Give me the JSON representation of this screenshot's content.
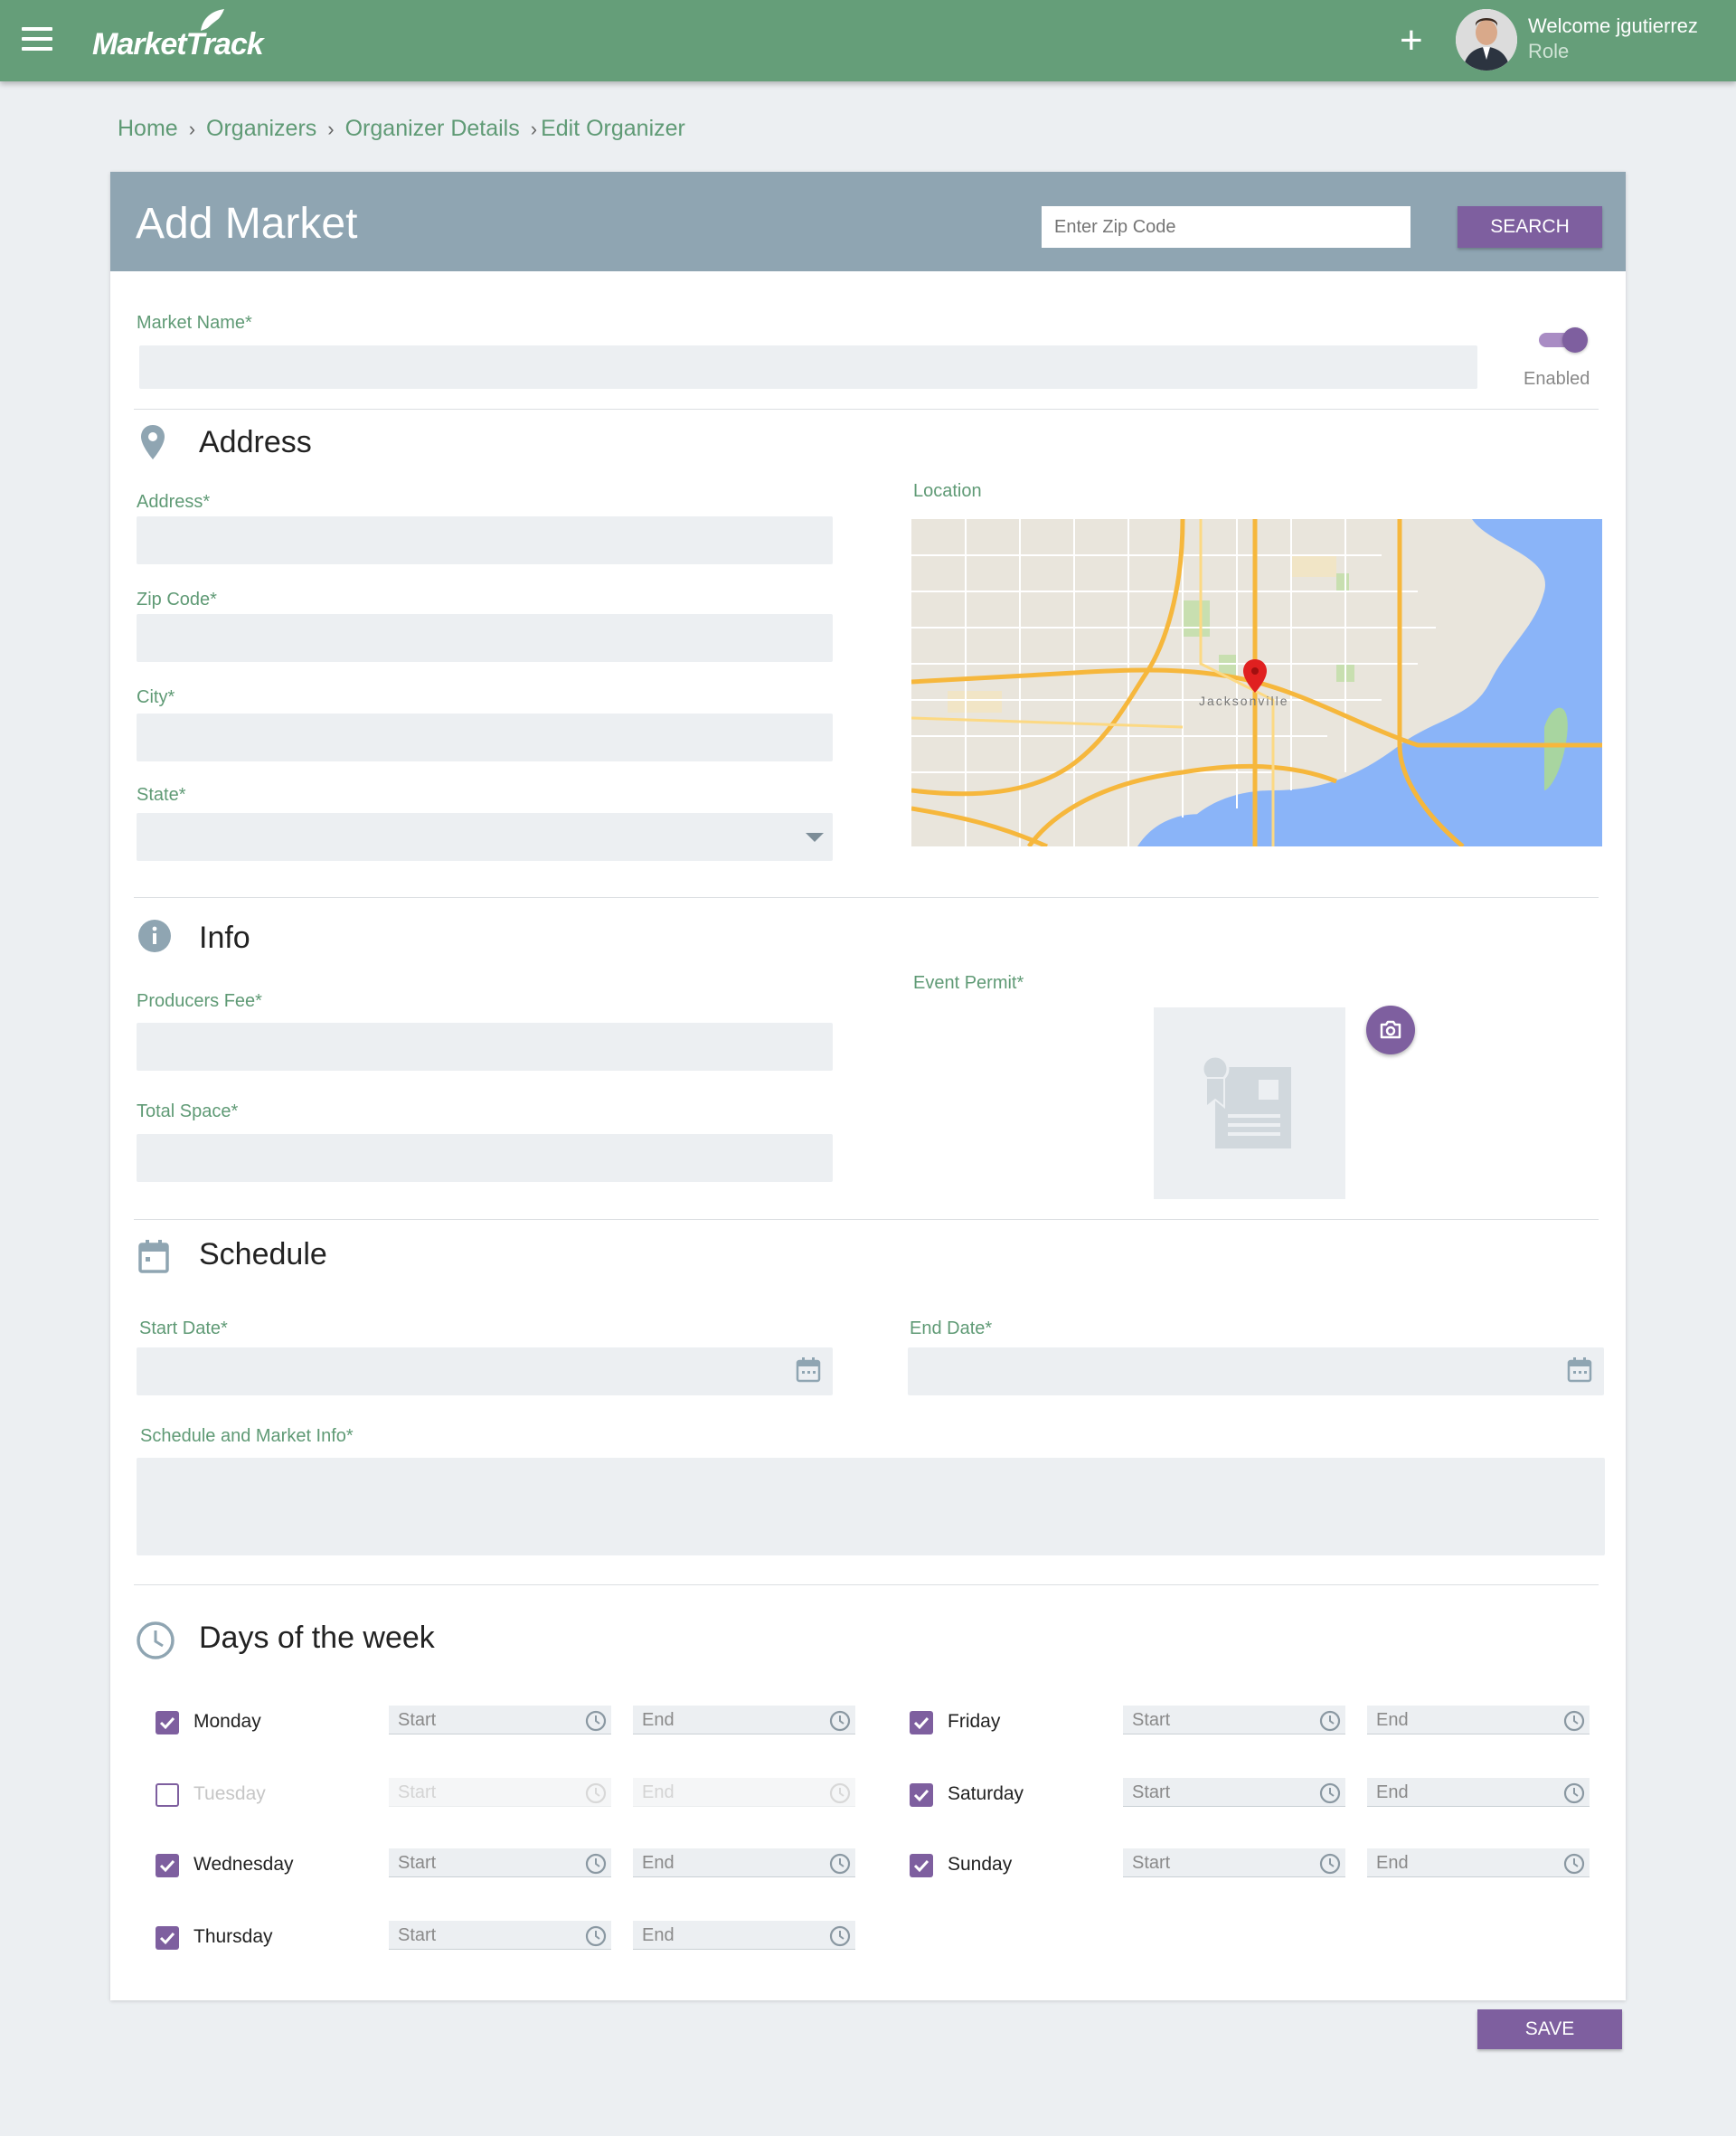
{
  "app": {
    "logo_text": "MarketTrack",
    "welcome": "Welcome jgutierrez",
    "role": "Role"
  },
  "breadcrumb": [
    "Home",
    "Organizers",
    "Organizer Details",
    "Edit Organizer"
  ],
  "header": {
    "title": "Add Market",
    "zip_placeholder": "Enter Zip Code",
    "search_label": "SEARCH"
  },
  "market_name": {
    "label": "Market Name*",
    "value": "",
    "toggle_label": "Enabled",
    "toggle_on": true
  },
  "address": {
    "section_title": "Address",
    "address_label": "Address*",
    "zip_label": "Zip Code*",
    "city_label": "City*",
    "state_label": "State*",
    "location_label": "Location",
    "map_city_label": "Jacksonville"
  },
  "info": {
    "section_title": "Info",
    "producers_fee_label": "Producers Fee*",
    "total_space_label": "Total Space*",
    "event_permit_label": "Event Permit*"
  },
  "schedule": {
    "section_title": "Schedule",
    "start_date_label": "Start Date*",
    "end_date_label": "End Date*",
    "info_label": "Schedule and Market Info*"
  },
  "days": {
    "section_title": "Days of the week",
    "start_placeholder": "Start",
    "end_placeholder": "End",
    "items": [
      {
        "name": "Monday",
        "checked": true
      },
      {
        "name": "Tuesday",
        "checked": false
      },
      {
        "name": "Wednesday",
        "checked": true
      },
      {
        "name": "Thursday",
        "checked": true
      },
      {
        "name": "Friday",
        "checked": true
      },
      {
        "name": "Saturday",
        "checked": true
      },
      {
        "name": "Sunday",
        "checked": true
      }
    ]
  },
  "actions": {
    "save_label": "SAVE"
  },
  "colors": {
    "topbar": "#659e79",
    "header": "#8fa5b2",
    "accent": "#7e5f9f",
    "label": "#5f9a75"
  }
}
